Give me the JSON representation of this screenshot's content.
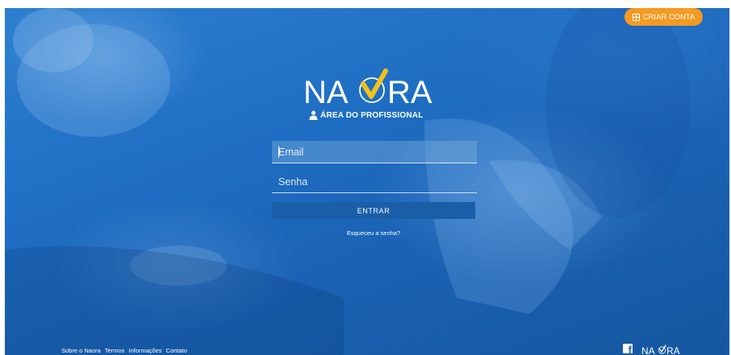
{
  "header": {
    "create_account_label": "CRIAR CONTA",
    "create_account_icon": "plus-square-icon"
  },
  "brand": {
    "logo_left": "NA",
    "logo_right": "RA",
    "logo_accent_color": "#f2c21b"
  },
  "login": {
    "area_title": "ÁREA DO PROFISSIONAL",
    "area_icon": "user-icon",
    "email_placeholder": "Email",
    "password_placeholder": "Senha",
    "submit_label": "ENTRAR",
    "forgot_label": "Esqueceu a senha?"
  },
  "footer": {
    "links": [
      "Sobre o Naora",
      "Termos",
      "Informações",
      "Contato"
    ],
    "social_icon": "facebook-icon",
    "logo_text_left": "NA",
    "logo_text_right": "RA"
  },
  "colors": {
    "accent": "#f59a22",
    "background": "#1f6fc4",
    "button": "#1b5ea8"
  }
}
